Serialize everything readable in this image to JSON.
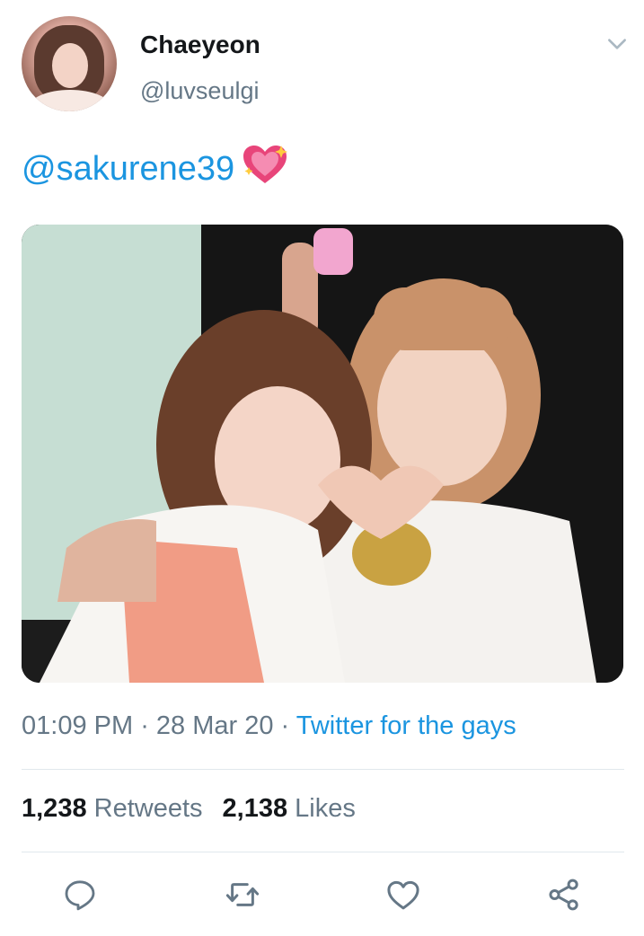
{
  "tweet": {
    "author": {
      "display_name": "Chaeyeon",
      "handle": "@luvseulgi"
    },
    "text": {
      "mention": "@sakurene39",
      "emoji": "sparkling-heart-emoji"
    },
    "media": {
      "type": "photo"
    },
    "meta": {
      "time": "01:09 PM",
      "separator": " · ",
      "date": "28 Mar 20",
      "source": "Twitter for the gays"
    },
    "stats": {
      "retweets_count": "1,238",
      "retweets_label": "Retweets",
      "likes_count": "2,138",
      "likes_label": "Likes"
    },
    "actions": [
      "reply-icon",
      "retweet-icon",
      "like-icon",
      "share-icon"
    ]
  },
  "colors": {
    "link": "#1b95e0",
    "text_primary": "#14171a",
    "text_secondary": "#657786",
    "divider": "#e1e8ed",
    "icon": "#657786"
  }
}
